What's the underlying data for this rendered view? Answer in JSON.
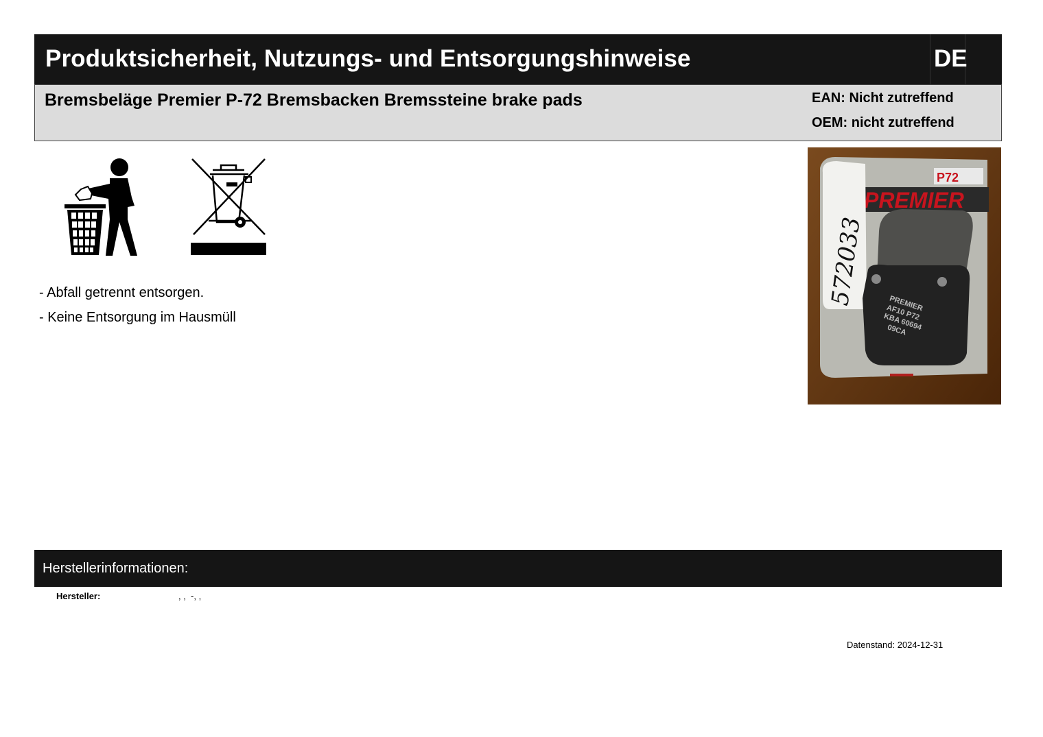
{
  "header": {
    "title": "Produktsicherheit, Nutzungs- und Entsorgungshinweise",
    "language": "DE"
  },
  "product": {
    "name": "Bremsbeläge Premier P-72 Bremsbacken Bremssteine brake pads",
    "ean": "EAN: Nicht zutreffend",
    "oem": "OEM: nicht zutreffend"
  },
  "photo": {
    "label_code": "P72",
    "brand": "PREMIER",
    "handwritten_number": "572033",
    "pad_lines": [
      "PREMIER",
      "AF10  P72",
      "KBA 60694",
      "09CA"
    ]
  },
  "disposal": {
    "icons": [
      "tidy-man-icon",
      "crossed-bin-icon"
    ],
    "notes": [
      "- Abfall getrennt entsorgen.",
      "- Keine Entsorgung im Hausmüll"
    ]
  },
  "manufacturer": {
    "section_title": "Herstellerinformationen:",
    "label": "Hersteller:",
    "value": ", ,  -, ,"
  },
  "footer": {
    "date": "Datenstand: 2024-12-31"
  }
}
